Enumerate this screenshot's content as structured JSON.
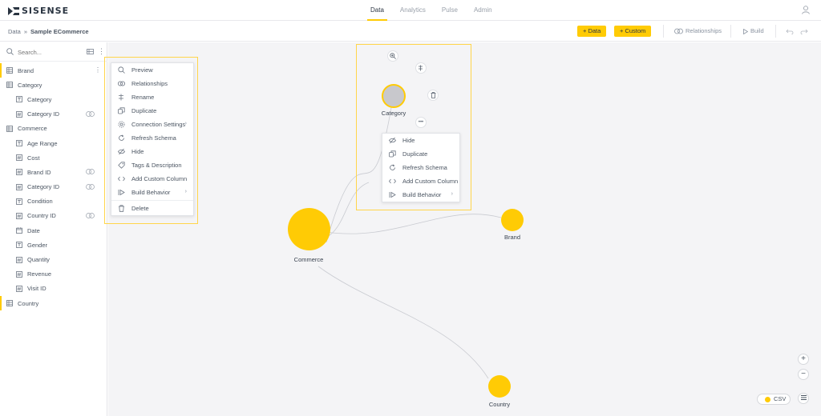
{
  "app": {
    "logo_text": "SISENSE",
    "nav_tabs": [
      "Data",
      "Analytics",
      "Pulse",
      "Admin"
    ],
    "active_tab": "Data"
  },
  "toolbar": {
    "breadcrumb_root": "Data",
    "breadcrumb_sep": "»",
    "breadcrumb_current": "Sample ECommerce",
    "add_data_label": "+ Data",
    "add_custom_label": "+ Custom",
    "relationships_label": "Relationships",
    "build_label": "Build"
  },
  "sidebar": {
    "search_placeholder": "Search...",
    "tree": [
      {
        "label": "Brand",
        "kind": "table",
        "selected": true
      },
      {
        "label": "Category",
        "kind": "table"
      },
      {
        "label": "Category",
        "kind": "column",
        "icon": "text-icon"
      },
      {
        "label": "Category ID",
        "kind": "column",
        "icon": "hash-icon",
        "relation": true
      },
      {
        "label": "Commerce",
        "kind": "table"
      },
      {
        "label": "Age Range",
        "kind": "column",
        "icon": "text-icon"
      },
      {
        "label": "Cost",
        "kind": "column",
        "icon": "hash-icon"
      },
      {
        "label": "Brand ID",
        "kind": "column",
        "icon": "hash-icon",
        "relation": true
      },
      {
        "label": "Category ID",
        "kind": "column",
        "icon": "hash-icon",
        "relation": true
      },
      {
        "label": "Condition",
        "kind": "column",
        "icon": "text-icon"
      },
      {
        "label": "Country ID",
        "kind": "column",
        "icon": "hash-icon",
        "relation": true
      },
      {
        "label": "Date",
        "kind": "column",
        "icon": "calendar-icon"
      },
      {
        "label": "Gender",
        "kind": "column",
        "icon": "text-icon"
      },
      {
        "label": "Quantity",
        "kind": "column",
        "icon": "hash-icon"
      },
      {
        "label": "Revenue",
        "kind": "column",
        "icon": "hash-icon"
      },
      {
        "label": "Visit ID",
        "kind": "column",
        "icon": "hash-icon"
      },
      {
        "label": "Country",
        "kind": "table",
        "selected": true
      }
    ]
  },
  "table_menu": {
    "items": [
      {
        "label": "Preview",
        "icon": "zoom-icon"
      },
      {
        "label": "Relationships",
        "icon": "link-icon"
      },
      {
        "label": "Rename",
        "icon": "rename-icon"
      },
      {
        "label": "Duplicate",
        "icon": "duplicate-icon"
      },
      {
        "label": "Connection Settings",
        "icon": "gear-icon",
        "submenu": true
      },
      {
        "label": "Refresh Schema",
        "icon": "refresh-icon"
      },
      {
        "label": "Hide",
        "icon": "eye-off-icon"
      },
      {
        "label": "Tags & Description",
        "icon": "tag-icon"
      },
      {
        "label": "Add Custom Column",
        "icon": "code-icon"
      },
      {
        "label": "Build Behavior",
        "icon": "build-icon",
        "submenu": true
      },
      {
        "label": "Delete",
        "icon": "trash-icon",
        "separator_before": true
      }
    ]
  },
  "node_menu": {
    "items": [
      {
        "label": "Hide",
        "icon": "eye-off-icon"
      },
      {
        "label": "Duplicate",
        "icon": "duplicate-icon"
      },
      {
        "label": "Refresh Schema",
        "icon": "refresh-icon"
      },
      {
        "label": "Add Custom Column",
        "icon": "code-icon"
      },
      {
        "label": "Build Behavior",
        "icon": "build-icon",
        "submenu": true
      }
    ]
  },
  "nodes": {
    "category": "Category",
    "commerce": "Commerce",
    "brand": "Brand",
    "country": "Country"
  },
  "canvas": {
    "zoom_in": "+",
    "zoom_out": "−",
    "csv_label": "CSV",
    "more_label": "•••"
  },
  "colors": {
    "accent": "#ffcb05",
    "node_selected": "#c8c8cc"
  }
}
